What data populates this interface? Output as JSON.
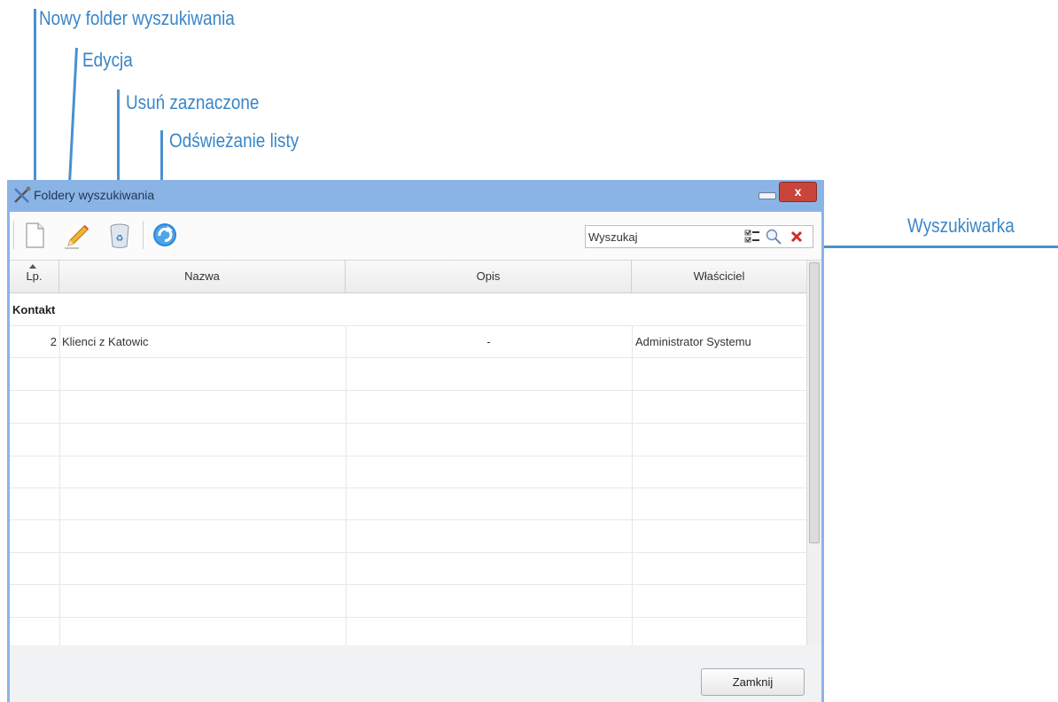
{
  "annotations": {
    "new_folder": "Nowy folder wyszukiwania",
    "edit": "Edycja",
    "delete_selected": "Usuń zaznaczone",
    "refresh": "Odświeżanie listy",
    "search": "Wyszukiwarka"
  },
  "window": {
    "title": "Foldery wyszukiwania",
    "close_glyph": "x"
  },
  "toolbar": {
    "buttons": [
      {
        "icon": "new-document-icon"
      },
      {
        "icon": "pencil-icon"
      },
      {
        "icon": "recycle-bin-icon"
      },
      {
        "icon": "refresh-icon"
      }
    ],
    "search": {
      "placeholder": "Wyszukaj",
      "options_icon": "search-options-icon",
      "search_icon": "magnifier-icon",
      "clear_icon": "clear-x-icon"
    }
  },
  "grid": {
    "columns": [
      {
        "label": "Lp.",
        "sorted": "ascending"
      },
      {
        "label": "Nazwa"
      },
      {
        "label": "Opis"
      },
      {
        "label": "Właściciel"
      }
    ],
    "groups": [
      {
        "label": "Kontakt",
        "rows": [
          {
            "lp": "2",
            "nazwa": "Klienci z Katowic",
            "opis": "-",
            "wlasciciel": "Administrator Systemu"
          }
        ]
      }
    ]
  },
  "footer": {
    "close_label": "Zamknij"
  },
  "colors": {
    "callout": "#3a86c8",
    "window_frame": "#8bb4e6",
    "close_button": "#c9443a"
  }
}
